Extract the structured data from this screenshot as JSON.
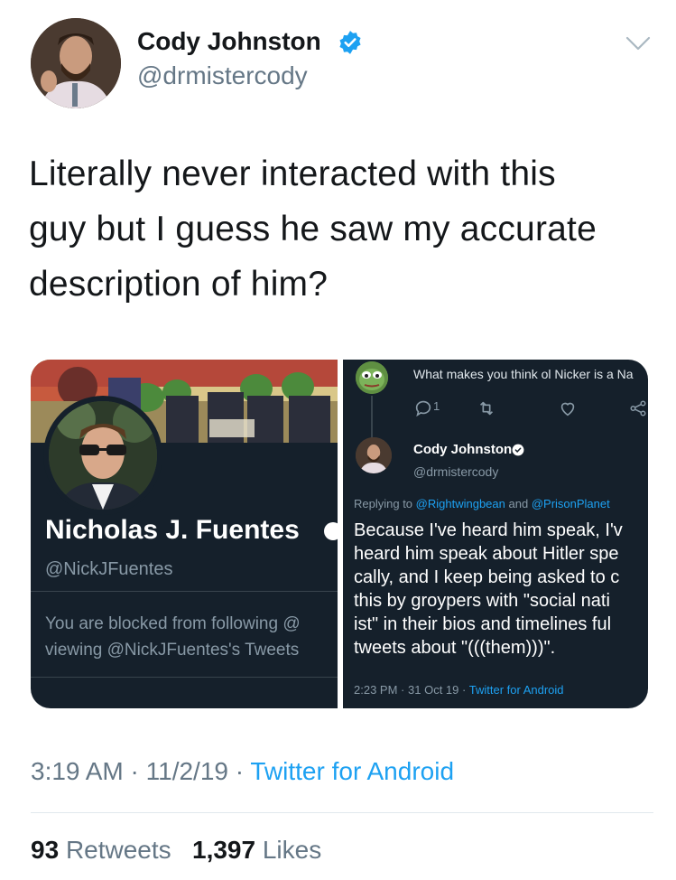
{
  "author": {
    "name": "Cody Johnston",
    "handle": "@drmistercody",
    "verified": true
  },
  "tweet": {
    "text_lines": [
      "Literally never interacted with this",
      "guy but I guess he saw my accurate",
      "description of him?"
    ],
    "time": "3:19 AM",
    "date": "11/2/19",
    "separator": "·",
    "source": "Twitter for Android"
  },
  "stats": {
    "retweets_count": "93",
    "retweets_label": "Retweets",
    "likes_count": "1,397",
    "likes_label": "Likes"
  },
  "screenshot_left": {
    "profile_name": "Nicholas J. Fuentes",
    "profile_handle": "@NickJFuentes",
    "blocked_line1": "You are blocked from following @",
    "blocked_line2": "viewing @NickJFuentes's Tweets"
  },
  "screenshot_right": {
    "prev_tweet_text": "What makes you think ol Nicker is a Na",
    "reply_count": "1",
    "author_name": "Cody Johnston",
    "author_handle": "@drmistercody",
    "replying_prefix": "Replying to",
    "replying_user1": "@Rightwingbean",
    "replying_and": "and",
    "replying_user2": "@PrisonPlanet",
    "body_lines": [
      "Because I've heard him speak, I'v",
      "heard him speak about Hitler spe",
      "cally, and I keep being asked to c",
      "this by groypers with \"social nati",
      "ist\" in their bios and timelines ful",
      "tweets about \"(((them)))\"."
    ],
    "time": "2:23 PM",
    "date": "31 Oct 19",
    "source": "Twitter for Android"
  },
  "colors": {
    "accent": "#1da1f2",
    "dark_bg": "#15202b",
    "muted": "#657786"
  }
}
